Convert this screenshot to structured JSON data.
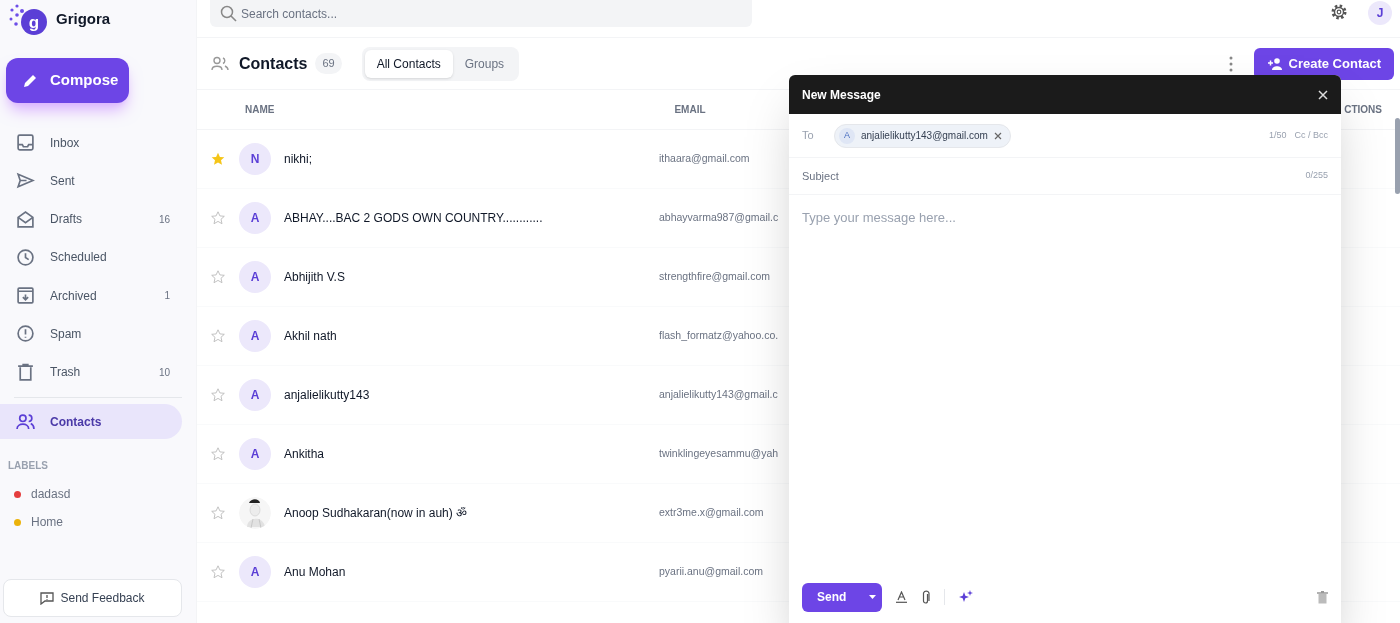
{
  "app": {
    "name": "Grigora",
    "logo_letter": "g"
  },
  "search": {
    "placeholder": "Search contacts..."
  },
  "user": {
    "initial": "J"
  },
  "compose_button": "Compose",
  "sidebar": {
    "items": [
      {
        "kind": "inbox",
        "label": "Inbox",
        "selected": false
      },
      {
        "kind": "sent",
        "label": "Sent",
        "selected": false
      },
      {
        "kind": "drafts",
        "label": "Drafts",
        "count": "16",
        "selected": false
      },
      {
        "kind": "scheduled",
        "label": "Scheduled",
        "selected": false
      },
      {
        "kind": "archived",
        "label": "Archived",
        "count": "1",
        "selected": false
      },
      {
        "kind": "spam",
        "label": "Spam",
        "selected": false
      },
      {
        "kind": "trash",
        "label": "Trash",
        "count": "10",
        "selected": false
      },
      {
        "kind": "contacts",
        "label": "Contacts",
        "selected": true
      }
    ],
    "labels_heading": "LABELS",
    "labels": [
      {
        "name": "dadasd",
        "color": "#e53e3e"
      },
      {
        "name": "Home",
        "color": "#ecb30b"
      }
    ],
    "feedback_button": "Send Feedback"
  },
  "contacts": {
    "title": "Contacts",
    "count": "69",
    "tabs": [
      {
        "label": "All Contacts",
        "selected": true
      },
      {
        "label": "Groups",
        "selected": false
      }
    ],
    "create_button": "Create Contact",
    "columns": {
      "name": "NAME",
      "email": "EMAIL",
      "column_3": "CTIONS"
    },
    "rows": [
      {
        "starred": true,
        "avatar": {
          "kind": "initial",
          "text": "N"
        },
        "name": "nikhi;",
        "email": "ithaara@gmail.com"
      },
      {
        "starred": false,
        "avatar": {
          "kind": "initial",
          "text": "A"
        },
        "name": "ABHAY....BAC 2 GODS OWN COUNTRY............",
        "email": "abhayvarma987@gmail.c"
      },
      {
        "starred": false,
        "avatar": {
          "kind": "initial",
          "text": "A"
        },
        "name": "Abhijith V.S",
        "email": "strengthfire@gmail.com"
      },
      {
        "starred": false,
        "avatar": {
          "kind": "initial",
          "text": "A"
        },
        "name": "Akhil nath",
        "email": "flash_formatz@yahoo.co."
      },
      {
        "starred": false,
        "avatar": {
          "kind": "initial",
          "text": "A"
        },
        "name": "anjalielikutty143",
        "email": "anjalielikutty143@gmail.c"
      },
      {
        "starred": false,
        "avatar": {
          "kind": "initial",
          "text": "A"
        },
        "name": "Ankitha",
        "email": "twinklingeyesammu@yah"
      },
      {
        "starred": false,
        "name": "Anoop Sudhakaran(now in auh) ॐ",
        "email": "extr3me.x@gmail.com"
      },
      {
        "starred": false,
        "avatar": {
          "kind": "initial",
          "text": "A"
        },
        "name": "Anu Mohan",
        "email": "pyarii.anu@gmail.com"
      }
    ]
  },
  "compose": {
    "title": "New Message",
    "to_label": "To",
    "recipients": [
      {
        "initial": "A",
        "email": "anjalielikutty143@gmail.com"
      }
    ],
    "recipient_count": "1/50",
    "cc_bcc": "Cc / Bcc",
    "subject": {
      "placeholder": "Subject"
    },
    "subject_count": "0/255",
    "body": {
      "placeholder": "Type your message here..."
    },
    "send_button": "Send"
  }
}
